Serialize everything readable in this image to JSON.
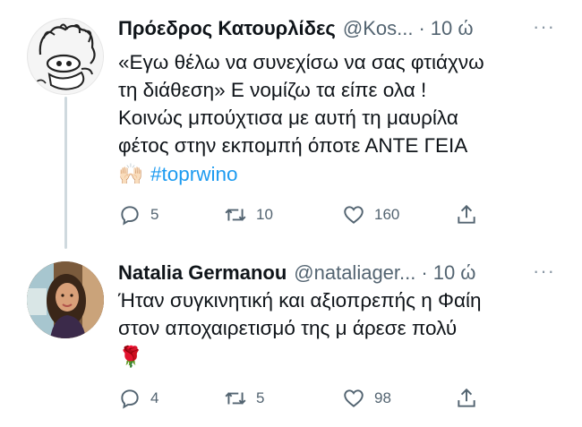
{
  "tweets": [
    {
      "name": "Πρόεδρος Κατουρλίδες",
      "handle": "@Kos...",
      "sep": "·",
      "time": "10 ώ",
      "more": "···",
      "text_lines": [
        "«Εγω θέλω να συνεχίσω να σας φτιάχνω",
        "τη διάθεση» Ε νομίζω τα είπε ολα !",
        "Κοινώς μπούχτισα με αυτή τη μαυρίλα",
        "φέτος στην εκπομπή όποτε ΑΝΤΕ ΓΕΙΑ"
      ],
      "emoji": "🙌🏻",
      "hashtag": "#toprwino",
      "replies": "5",
      "retweets": "10",
      "likes": "160"
    },
    {
      "name": "Natalia Germanou",
      "handle": "@nataliager...",
      "sep": "·",
      "time": "10 ώ",
      "more": "···",
      "text_lines": [
        "Ήταν συγκινητική και αξιοπρεπής η Φαίη",
        "στον αποχαιρετισμό της μ άρεσε πολύ"
      ],
      "emoji": "🌹",
      "replies": "4",
      "retweets": "5",
      "likes": "98"
    }
  ],
  "colors": {
    "link": "#1d9bf0",
    "secondary_text": "#536471",
    "thread_line": "#cfd9de"
  },
  "icons": [
    "reply-icon",
    "retweet-icon",
    "like-icon",
    "share-icon",
    "more-options-icon"
  ]
}
